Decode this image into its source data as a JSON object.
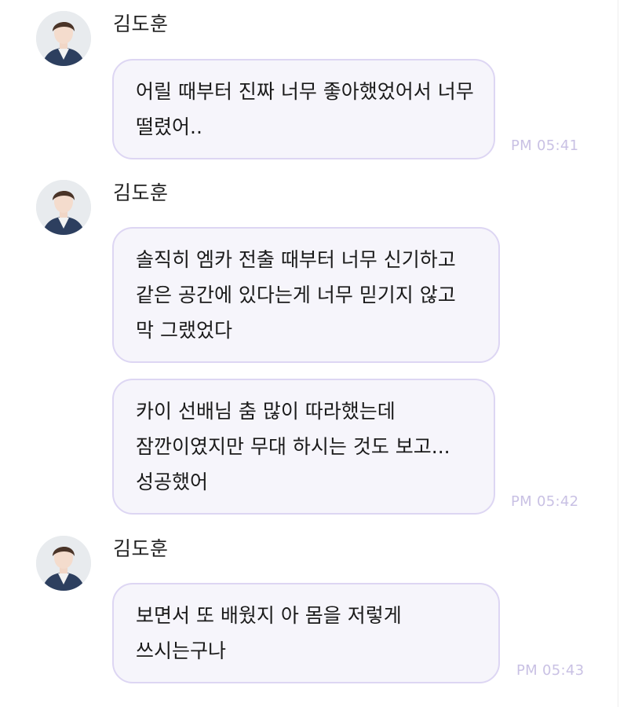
{
  "sender": {
    "name": "김도훈",
    "avatar_icon": "profile-photo"
  },
  "messages": [
    {
      "text": "어릴 때부터 진짜 너무 좋아했었어서 너무 떨렸어..",
      "time": "PM 05:41"
    },
    {
      "text": "솔직히 엠카 전출 때부터 너무 신기하고 같은 공간에 있다는게 너무 믿기지 않고 막 그랬었다",
      "time": ""
    },
    {
      "text": "카이 선배님 춤 많이 따라했는데 잠깐이였지만 무대 하시는 것도 보고... 성공했어",
      "time": "PM 05:42"
    },
    {
      "text": "보면서 또 배웠지 아 몸을 저렇게 쓰시는구나",
      "time": "PM 05:43"
    }
  ],
  "colors": {
    "bubble_bg": "#f6f5fb",
    "bubble_border": "#ddd6f3",
    "timestamp": "#c9c1e4"
  }
}
